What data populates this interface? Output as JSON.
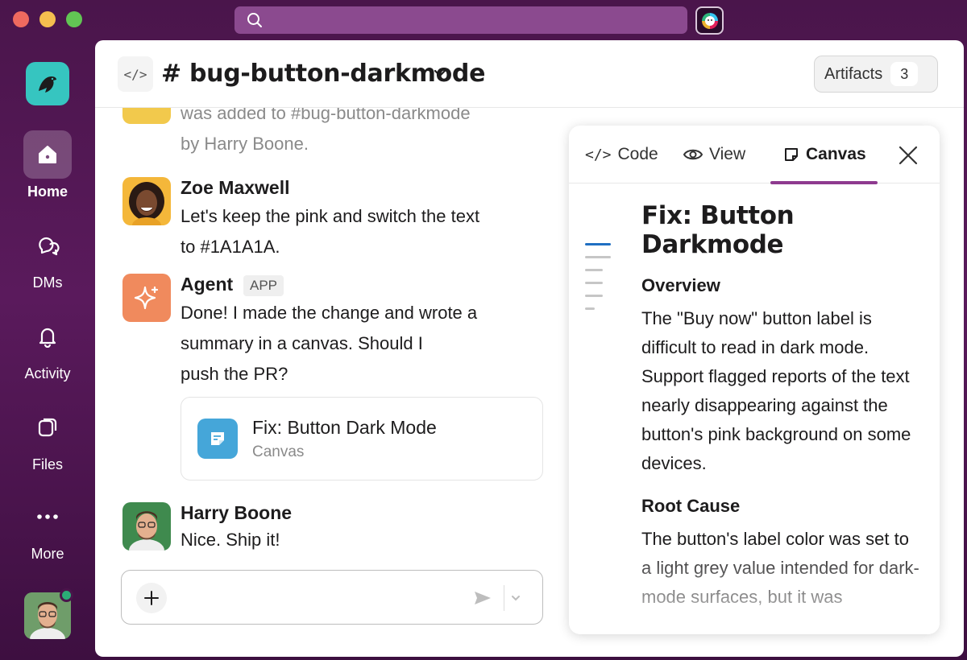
{
  "window": {
    "search": {
      "placeholder": ""
    }
  },
  "sidebar": {
    "items": [
      {
        "label": "Home",
        "icon": "home-icon",
        "active": true
      },
      {
        "label": "DMs",
        "icon": "dms-icon"
      },
      {
        "label": "Activity",
        "icon": "bell-icon"
      },
      {
        "label": "Files",
        "icon": "files-icon"
      },
      {
        "label": "More",
        "icon": "more-icon"
      }
    ]
  },
  "header": {
    "channel_name": "# bug-button-darkmode",
    "artifacts_label": "Artifacts",
    "artifacts_count": "3"
  },
  "messages": {
    "system_line1": "was added to #bug-button-darkmode",
    "system_line2": "by Harry Boone.",
    "zoe": {
      "sender": "Zoe Maxwell",
      "line1": "Let's keep the pink and switch the text",
      "line2": "to #1A1A1A."
    },
    "agent": {
      "sender": "Agent",
      "tag": "APP",
      "line1": "Done! I made the change and wrote a",
      "line2": "summary in a canvas. Should I",
      "line3": "push the PR?"
    },
    "canvas_card": {
      "title": "Fix: Button Dark Mode",
      "subtitle": "Canvas"
    },
    "harry": {
      "sender": "Harry Boone",
      "line1": "Nice. Ship it!"
    }
  },
  "composer": {
    "placeholder": ""
  },
  "artifact_panel": {
    "tabs": [
      {
        "label": "Code",
        "icon": "code-icon"
      },
      {
        "label": "View",
        "icon": "eye-icon"
      },
      {
        "label": "Canvas",
        "icon": "canvas-icon",
        "active": true
      }
    ],
    "doc": {
      "title": "Fix: Button Darkmode",
      "h_overview": "Overview",
      "overview": "The \"Buy now\" button label is difficult to read in dark mode. Support flagged reports of the text nearly disappearing against the button's pink background on some devices.",
      "h_root": "Root Cause",
      "root": "The button's label color was set to a light grey value intended for dark-mode surfaces, but it was"
    }
  },
  "colors": {
    "aubergine": "#4a154b",
    "active_tab": "#8e3a8f",
    "outline_active": "#1f6fc2",
    "canvas_icon": "#45a6d9",
    "agent_avatar": "#f08a5d",
    "workspace_logo": "#36c5c0",
    "presence": "#2bac76"
  }
}
